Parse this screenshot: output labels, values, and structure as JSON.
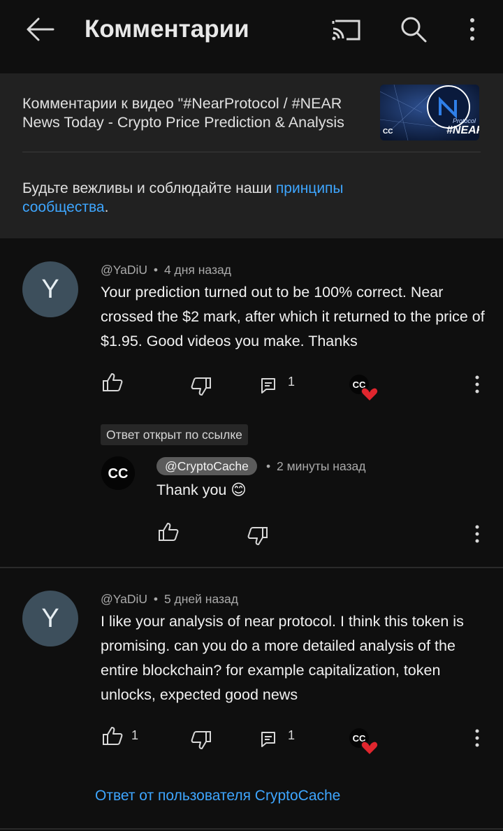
{
  "header": {
    "title": "Комментарии"
  },
  "video": {
    "title_line1": "Комментарии к видео \"#NearProtocol / #NEAR",
    "title_line2": "News Today - Crypto Price Prediction & Analysis",
    "thumb_text_small": "Protocol",
    "thumb_text_big": "#NEAR",
    "thumb_logo": "CC"
  },
  "rules": {
    "prefix": "Будьте вежливы и соблюдайте наши ",
    "link1": "принципы",
    "link2": "сообщества",
    "suffix": "."
  },
  "comments": [
    {
      "avatar_letter": "Y",
      "author": "@YaDiU",
      "time": "4 дня назад",
      "text": "Your prediction turned out to be 100% correct. Near crossed the $2 mark, after which it returned to the price of $1.95. Good videos you make. Thanks",
      "likes": "",
      "replies": "1",
      "hearted": true,
      "linked_label": "Ответ открыт по ссылке",
      "reply": {
        "author": "@CryptoCache",
        "time": "2 минуты назад",
        "text": "Thank you 😊"
      }
    },
    {
      "avatar_letter": "Y",
      "author": "@YaDiU",
      "time": "5 дней назад",
      "text": "I like your analysis of near protocol. I think this token is promising. can you do a more detailed analysis of the entire blockchain? for example capitalization, token unlocks, expected good news",
      "likes": "1",
      "replies": "1",
      "hearted": true,
      "replies_link": "Ответ от пользователя CryptoCache"
    }
  ],
  "meta_separator": "•",
  "colors": {
    "background": "#0f0f0f",
    "card": "#212121",
    "link": "#3ea6ff",
    "heart": "#e0262e",
    "avatar": "#3d4f5c"
  },
  "icons": [
    "back-arrow-icon",
    "cast-icon",
    "search-icon",
    "more-vert-icon",
    "thumb-up-icon",
    "thumb-down-icon",
    "reply-icon",
    "creator-heart-icon"
  ]
}
